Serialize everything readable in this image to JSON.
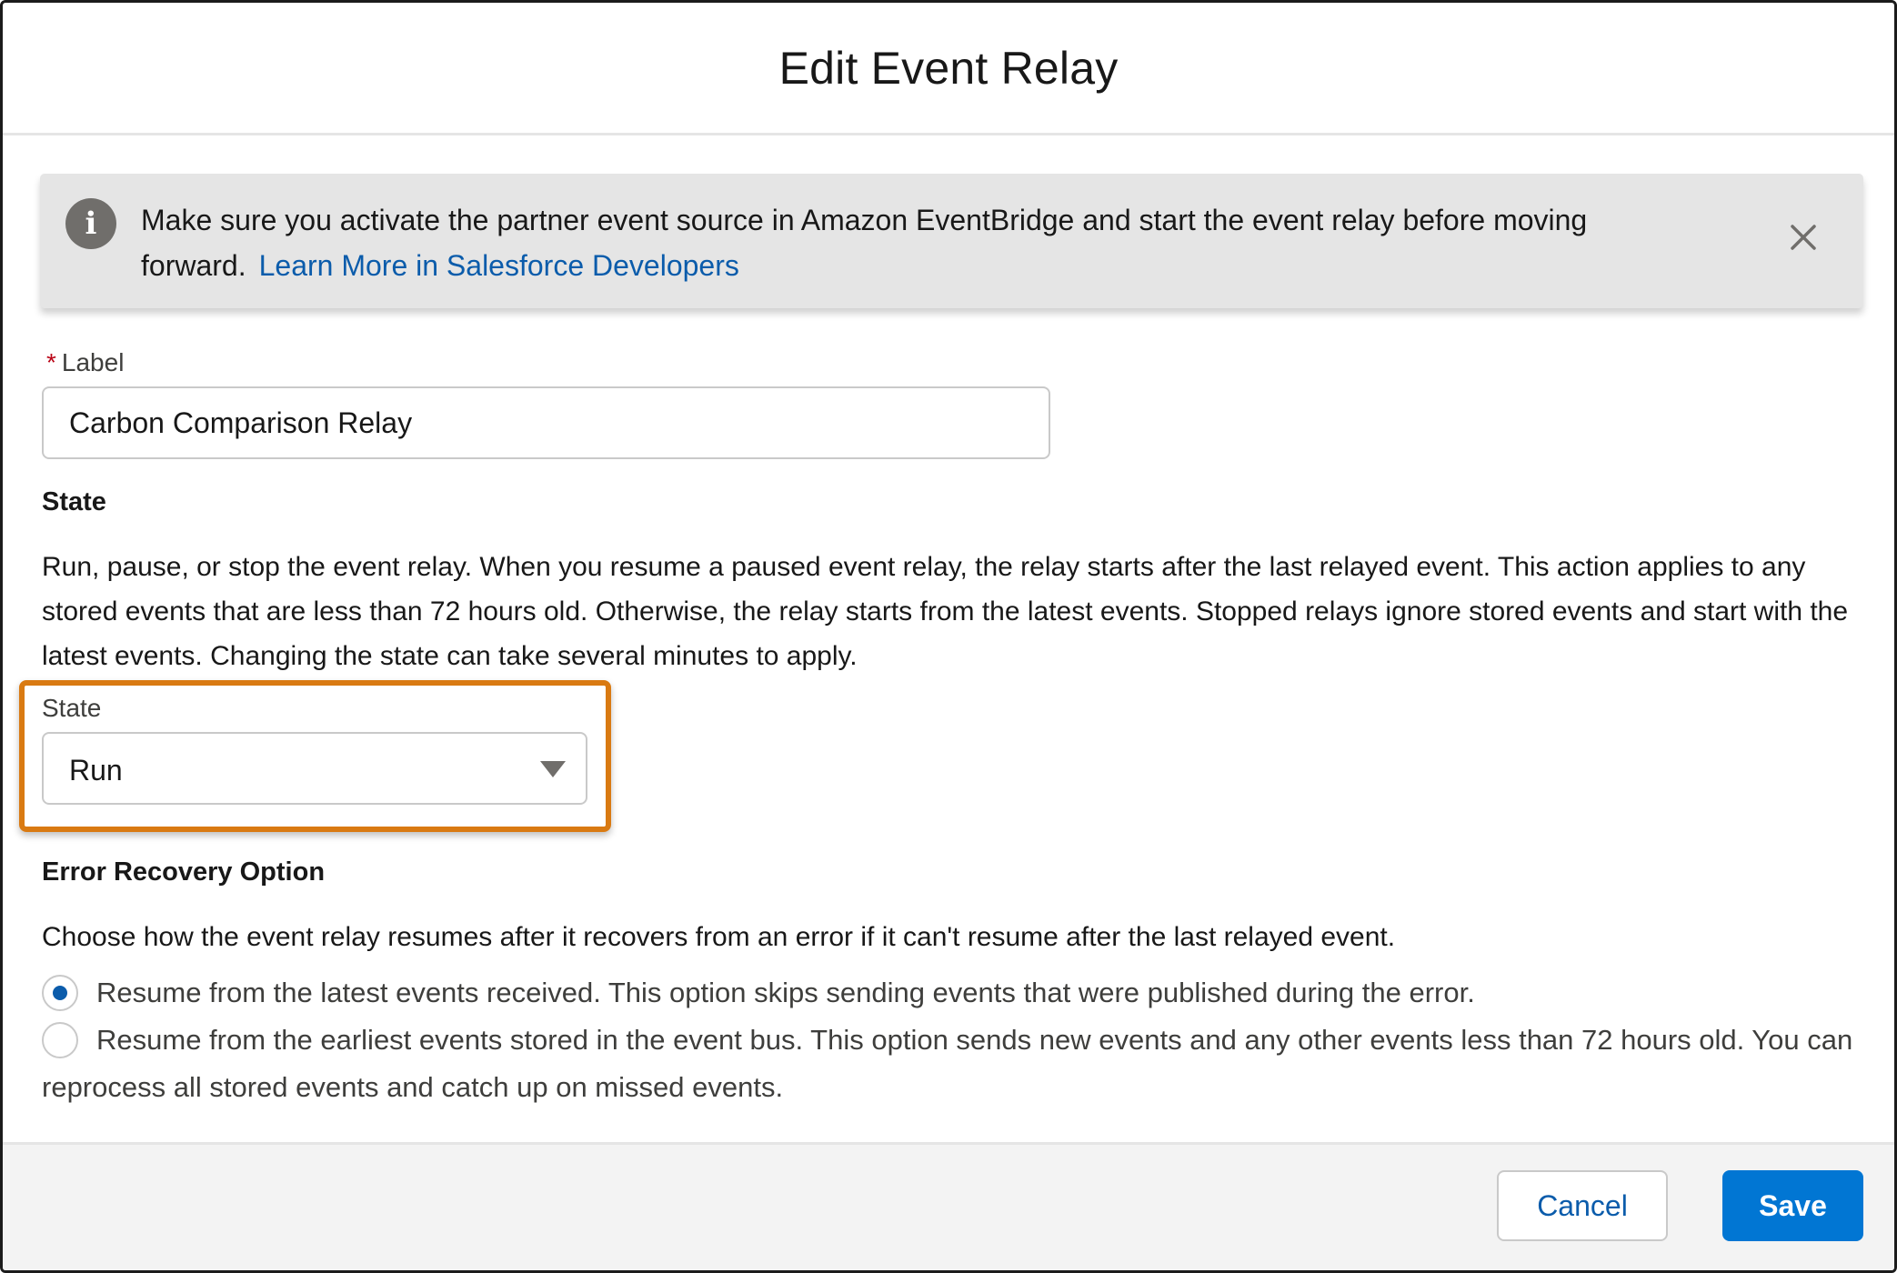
{
  "modal": {
    "title": "Edit Event Relay"
  },
  "notice": {
    "icon": "info-icon",
    "text": "Make sure you activate the partner event source in Amazon EventBridge and start the event relay before moving forward.",
    "link_label": "Learn More in Salesforce Developers",
    "close_icon": "close-icon"
  },
  "label_field": {
    "required_marker": "*",
    "label": "Label",
    "value": "Carbon Comparison Relay"
  },
  "state_section": {
    "heading": "State",
    "description": "Run, pause, or stop the event relay. When you resume a paused event relay, the relay starts after the last relayed event. This action applies to any stored events that are less than 72 hours old. Otherwise, the relay starts from the latest events. Stopped relays ignore stored events and start with the latest events. Changing the state can take several minutes to apply.",
    "select_label": "State",
    "select_value": "Run",
    "highlight_color": "#d97a12"
  },
  "error_recovery": {
    "heading": "Error Recovery Option",
    "description": "Choose how the event relay resumes after it recovers from an error if it can't resume after the last relayed event.",
    "options": [
      {
        "label": "Resume from the latest events received. This option skips sending events that were published during the error.",
        "checked": true
      },
      {
        "label": "Resume from the earliest events stored in the event bus. This option sends new events and any other events less than 72 hours old. You can reprocess all stored events and catch up on missed events.",
        "checked": false
      }
    ]
  },
  "footer": {
    "cancel_label": "Cancel",
    "save_label": "Save"
  },
  "colors": {
    "brand": "#0176d3",
    "link": "#0b5cab",
    "required": "#ba0517"
  }
}
